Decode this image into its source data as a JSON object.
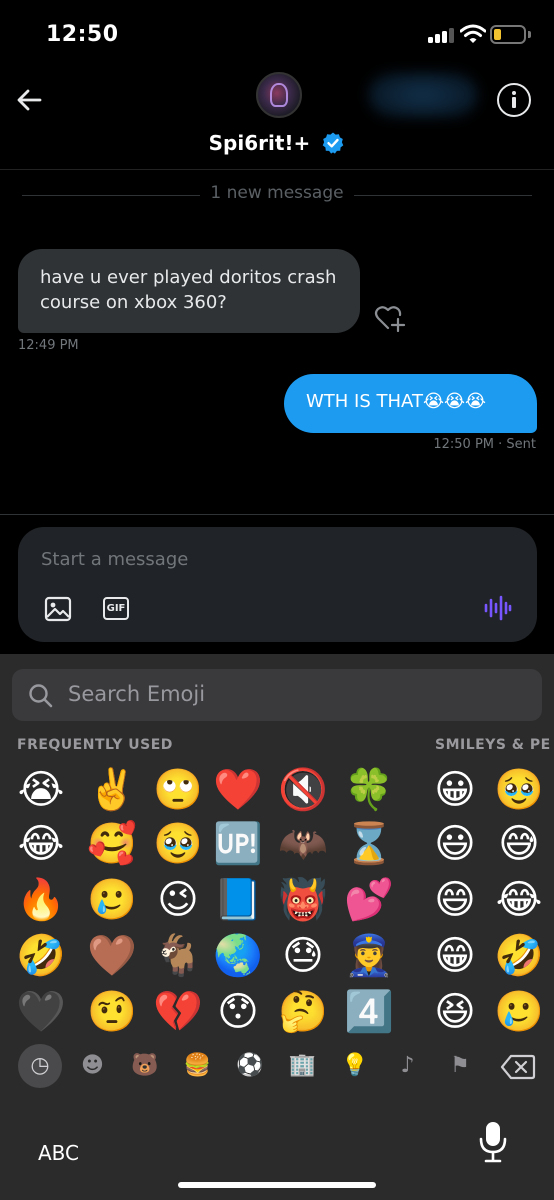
{
  "status_bar": {
    "time": "12:50",
    "battery_level": 0.25
  },
  "header": {
    "username": "Spi6rit!+",
    "back_label": "",
    "info_label": ""
  },
  "chat": {
    "divider": "1 new message",
    "incoming": {
      "text": "have u ever played doritos crash course on xbox 360?",
      "time": "12:49 PM"
    },
    "outgoing": {
      "text": "WTH IS THAT😭😭😭",
      "time": "12:50 PM · Sent"
    }
  },
  "composer": {
    "placeholder": "Start a message",
    "gif_label": "GIF"
  },
  "keyboard": {
    "search_placeholder": "Search Emoji",
    "sections": [
      "FREQUENTLY USED",
      "SMILEYS & PE"
    ],
    "frequently_used": [
      [
        "😭",
        "✌️",
        "🙄",
        "❤️",
        "🔇",
        "🍀"
      ],
      [
        "😂",
        "🥰",
        "🥹",
        "🆙",
        "🦇",
        "⌛"
      ],
      [
        "🔥",
        "🥲",
        "😉",
        "📘",
        "👹",
        "💕"
      ],
      [
        "🤣",
        "🤎",
        "🐐",
        "🌏",
        "😓",
        "👮‍♀️"
      ],
      [
        "🖤",
        "🤨",
        "💔",
        "😯",
        "🤔",
        "4️⃣"
      ]
    ],
    "smileys": [
      [
        "😀",
        "🥹"
      ],
      [
        "😃",
        "😅"
      ],
      [
        "😄",
        "😂"
      ],
      [
        "😁",
        "🤣"
      ],
      [
        "😆",
        "🥲"
      ]
    ],
    "categories": [
      {
        "name": "recent-icon",
        "glyph": "◷",
        "active": true
      },
      {
        "name": "smileys-icon",
        "glyph": "☻",
        "active": false
      },
      {
        "name": "animals-icon",
        "glyph": "🐻",
        "active": false
      },
      {
        "name": "food-icon",
        "glyph": "🍔",
        "active": false
      },
      {
        "name": "activity-icon",
        "glyph": "⚽",
        "active": false
      },
      {
        "name": "travel-icon",
        "glyph": "🏢",
        "active": false
      },
      {
        "name": "objects-icon",
        "glyph": "💡",
        "active": false
      },
      {
        "name": "symbols-icon",
        "glyph": "♪",
        "active": false
      },
      {
        "name": "flags-icon",
        "glyph": "⚑",
        "active": false
      }
    ],
    "abc_label": "ABC"
  },
  "colors": {
    "accent": "#1d9bf0",
    "voice": "#7856ff",
    "verified": "#1d9bf0"
  }
}
